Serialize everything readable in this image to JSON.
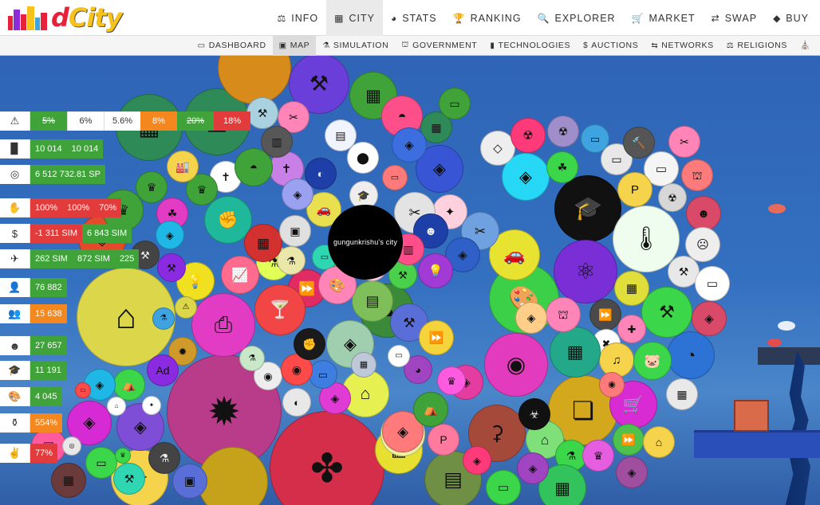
{
  "brand": {
    "logo_text_d": "d",
    "logo_text_city": "City"
  },
  "main_nav": [
    {
      "label": "INFO",
      "icon": "⚖"
    },
    {
      "label": "CITY",
      "icon": "▦",
      "active": true
    },
    {
      "label": "STATS",
      "icon": "◕"
    },
    {
      "label": "RANKING",
      "icon": "🏆"
    },
    {
      "label": "EXPLORER",
      "icon": "🔍"
    },
    {
      "label": "MARKET",
      "icon": "🛒"
    },
    {
      "label": "SWAP",
      "icon": "⇄"
    },
    {
      "label": "BUY",
      "icon": "◆"
    }
  ],
  "sub_nav": [
    {
      "label": "DASHBOARD",
      "icon": "▭"
    },
    {
      "label": "MAP",
      "icon": "▣",
      "active": true
    },
    {
      "label": "SIMULATION",
      "icon": "⚗"
    },
    {
      "label": "GOVERNMENT",
      "icon": "⛫"
    },
    {
      "label": "TECHNOLOGIES",
      "icon": "▮"
    },
    {
      "label": "AUCTIONS",
      "icon": "$"
    },
    {
      "label": "NETWORKS",
      "icon": "⇆"
    },
    {
      "label": "RELIGIONS",
      "icon": "⚖"
    },
    {
      "label": "",
      "icon": "⛪"
    }
  ],
  "stats": [
    {
      "icon": "⚠",
      "cells": [
        {
          "text": "5%",
          "color": "green",
          "strike": true
        },
        {
          "text": "6%",
          "color": "white"
        },
        {
          "text": "5.6%",
          "color": "white"
        },
        {
          "text": "8%",
          "color": "orange"
        },
        {
          "text": "20%",
          "color": "green",
          "strike": true
        },
        {
          "text": "18%",
          "color": "red"
        }
      ]
    },
    {
      "icon": "▉",
      "cells": [
        {
          "text": "10 014",
          "color": "green"
        },
        {
          "text": "10 014",
          "color": "green"
        }
      ]
    },
    {
      "icon": "◎",
      "cells": [
        {
          "text": "6 512 732.81 SP",
          "color": "green"
        }
      ]
    },
    {
      "icon": "✋",
      "cells": [
        {
          "text": "100%",
          "color": "red"
        },
        {
          "text": "100%",
          "color": "red"
        },
        {
          "text": "70%",
          "color": "red"
        }
      ]
    },
    {
      "icon": "$",
      "cells": [
        {
          "text": "-1 311 SIM",
          "color": "red"
        },
        {
          "text": "6 843 SIM",
          "color": "green"
        }
      ]
    },
    {
      "icon": "✈",
      "cells": [
        {
          "text": "262 SIM",
          "color": "green"
        },
        {
          "text": "872 SIM",
          "color": "green"
        },
        {
          "text": "225",
          "color": "green"
        }
      ]
    },
    {
      "icon": "👤",
      "cells": [
        {
          "text": "76 882",
          "color": "green"
        }
      ]
    },
    {
      "icon": "👥",
      "cells": [
        {
          "text": "15 638",
          "color": "orange"
        }
      ]
    },
    {
      "icon": "☻",
      "cells": [
        {
          "text": "27 657",
          "color": "green"
        }
      ]
    },
    {
      "icon": "🎓",
      "cells": [
        {
          "text": "11 191",
          "color": "green"
        }
      ]
    },
    {
      "icon": "🎨",
      "cells": [
        {
          "text": "4 045",
          "color": "green"
        }
      ]
    },
    {
      "icon": "⚱",
      "cells": [
        {
          "text": "554%",
          "color": "orange"
        }
      ]
    },
    {
      "icon": "✌",
      "cells": [
        {
          "text": "77%",
          "color": "red"
        }
      ]
    }
  ],
  "city_label": "gungunkrishu's city",
  "colors": {
    "green": "#3fa33a",
    "red": "#e23b3b",
    "orange": "#f5871f"
  }
}
